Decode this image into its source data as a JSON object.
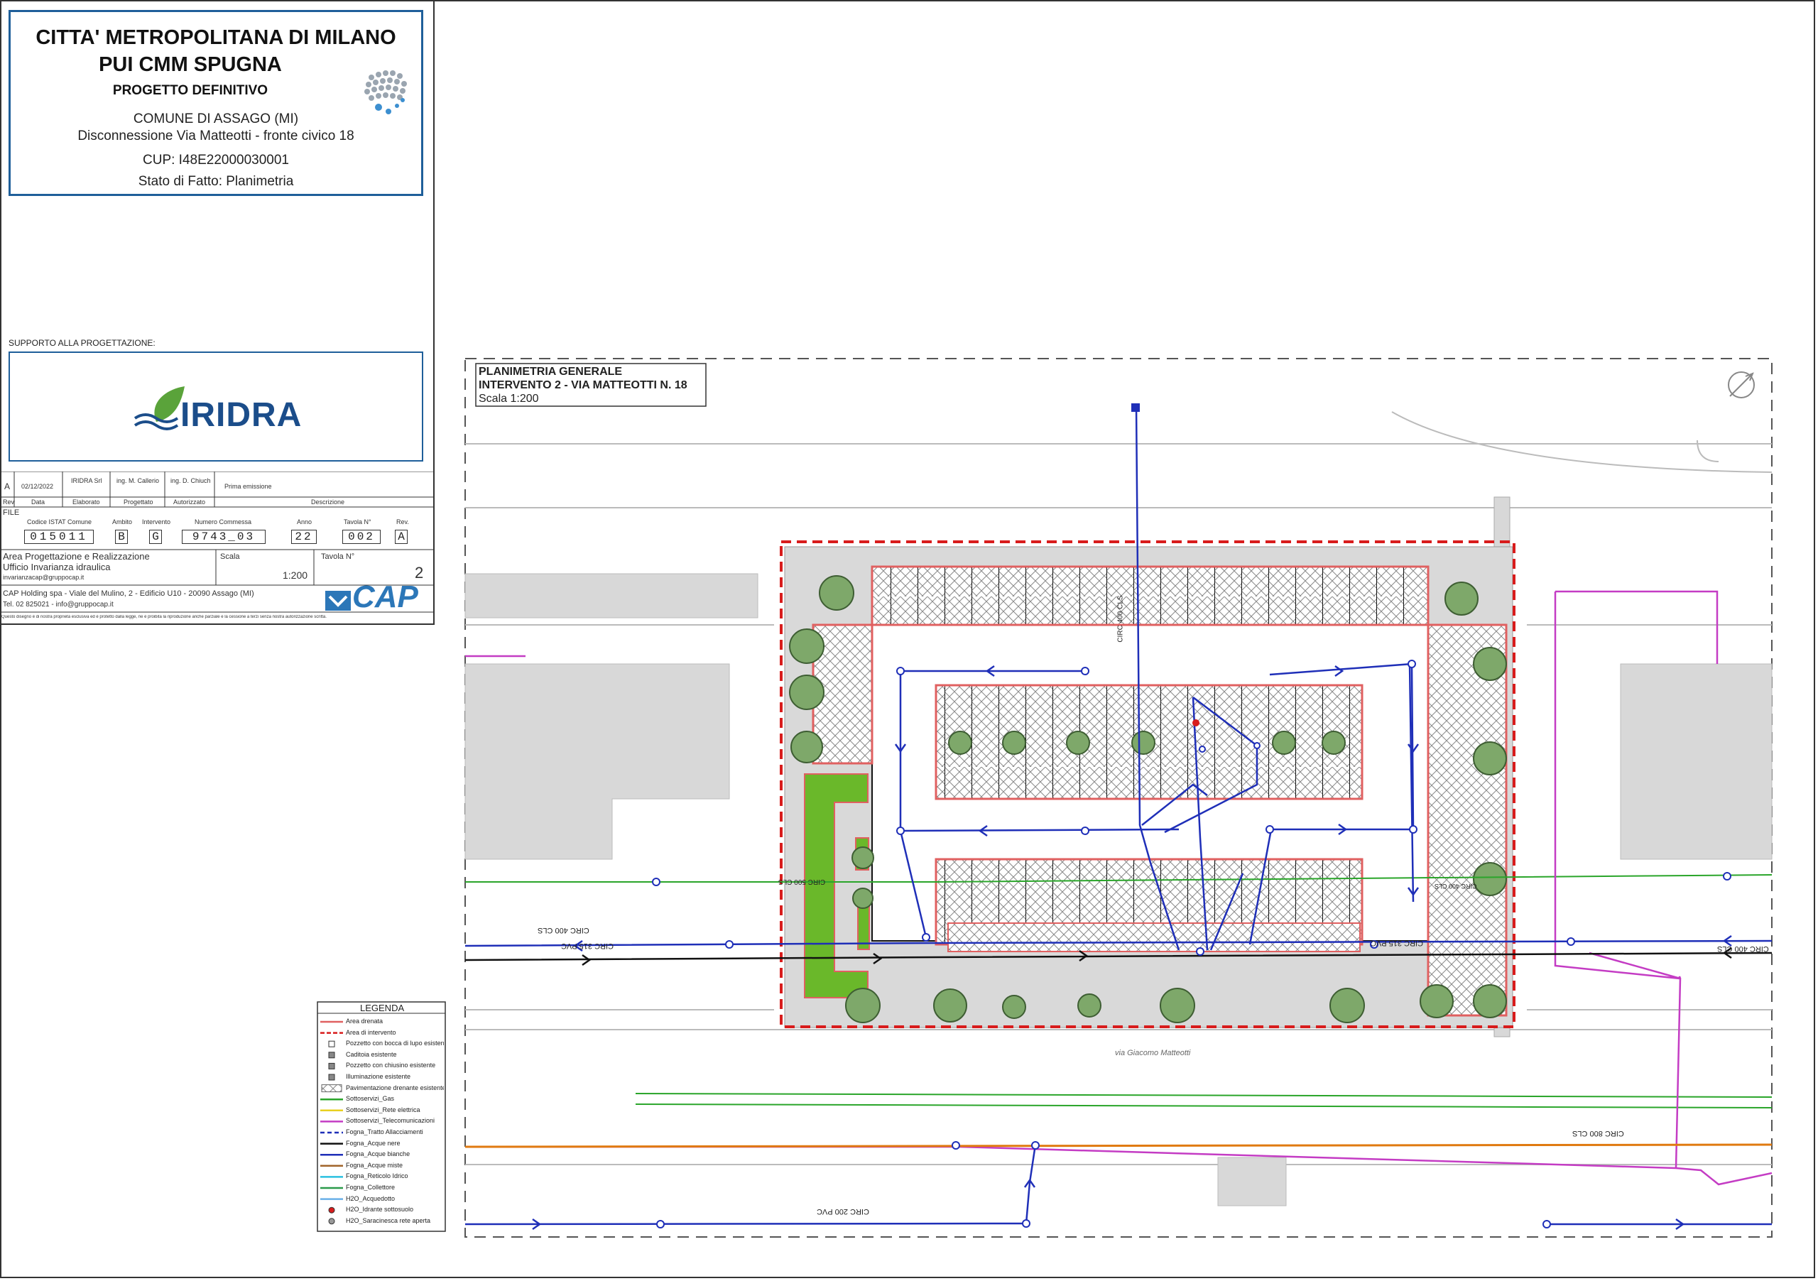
{
  "header": {
    "title_line1": "CITTA' METROPOLITANA DI MILANO",
    "title_line2": "PUI CMM SPUGNA",
    "phase": "PROGETTO DEFINITIVO",
    "comune": "COMUNE DI ASSAGO (MI)",
    "subject": "Disconnessione Via Matteotti - fronte civico 18",
    "cup": "CUP: I48E22000030001",
    "state": "Stato di Fatto: Planimetria"
  },
  "support": {
    "label": "SUPPORTO ALLA PROGETTAZIONE:",
    "logo_text": "IRIDRA"
  },
  "revision": {
    "rev": "A",
    "date": "02/12/2022",
    "elaborato": "IRIDRA Srl",
    "progettato": "ing. M. Callerio",
    "autorizzato": "ing. D. Chiuch",
    "descrizione": "Prima emissione",
    "headers": [
      "Rev",
      "Data",
      "Elaborato",
      "Progettato",
      "Autorizzato",
      "Descrizione"
    ]
  },
  "file": {
    "label": "FILE",
    "headers": [
      "Codice ISTAT Comune",
      "Ambito",
      "Intervento",
      "Numero Commessa",
      "Anno",
      "Tavola N°",
      "Rev."
    ],
    "istat": "015011",
    "ambito": "B",
    "intervento": "G",
    "commessa": "9743_03",
    "anno": "22",
    "tavola": "002",
    "rev": "A"
  },
  "office": {
    "area": "Area Progettazione e Realizzazione",
    "ufficio": "Ufficio Invarianza idraulica",
    "email": "invarianzacap@gruppocap.it",
    "scala_label": "Scala",
    "scala_value": "1:200",
    "tavola_label": "Tavola N°",
    "tavola_value": "2",
    "company": "CAP Holding spa - Viale del Mulino, 2 - Edificio U10 - 20090 Assago (MI)",
    "contacts": "Tel. 02 825021 - info@gruppocap.it",
    "cap_logo": "CAP",
    "disclaimer": "Questo disegno è di nostra proprietà esclusiva ed è protetto dalla legge, ne è proibita la riproduzione anche parziale e la cessione a terzi senza nostra autorizzazione scritta."
  },
  "plan": {
    "title1": "PLANIMETRIA GENERALE",
    "title2": "INTERVENTO 2 - VIA MATTEOTTI N. 18",
    "scale": "Scala 1:200",
    "street": "via Giacomo Matteotti",
    "pipe_labels": {
      "circ400_vertical": "CIRC 400 CLS",
      "circ400_left": "CIRC 400 CLS",
      "circ315_left": "CIRC 315 PVC",
      "circ315_right": "CIRC 315 PVC",
      "circ400_right": "CIRC 400 CLS",
      "circ800": "CIRC 800 CLS",
      "circ200": "CIRC 200 PVC",
      "circ500": "CIRC 500 CLS",
      "circ_small": "CIRC 400 CLS"
    },
    "colors": {
      "drain_area": "#e06060",
      "intervention": "#d81c1c",
      "sewer_white": "#1f2fb8",
      "sewer_black": "#111111",
      "gas": "#2aa52a",
      "telecom": "#c43cc4",
      "aqueduct": "#e07a10",
      "green_strip": "#6ab82a"
    }
  },
  "legend": {
    "title": "LEGENDA",
    "items": [
      {
        "label": "Area drenata",
        "style": "drain"
      },
      {
        "label": "Area di intervento",
        "style": "intervention"
      },
      {
        "label": "Pozzetto con bocca di lupo esistente",
        "style": "symbol"
      },
      {
        "label": "Caditoia esistente",
        "style": "square"
      },
      {
        "label": "Pozzetto con chiusino esistente",
        "style": "square-small"
      },
      {
        "label": "Illuminazione esistente",
        "style": "lamp"
      },
      {
        "label": "Pavimentazione drenante esistente",
        "style": "hatch"
      },
      {
        "label": "Sottoservizi_Gas",
        "style": "gas"
      },
      {
        "label": "Sottoservizi_Rete elettrica",
        "style": "electric"
      },
      {
        "label": "Sottoservizi_Telecomunicazioni",
        "style": "telecom"
      },
      {
        "label": "Fogna_Tratto Allacciamenti",
        "style": "dash-blue"
      },
      {
        "label": "Fogna_Acque nere",
        "style": "black"
      },
      {
        "label": "Fogna_Acque bianche",
        "style": "blue"
      },
      {
        "label": "Fogna_Acque miste",
        "style": "brown"
      },
      {
        "label": "Fogna_Reticolo Idrico",
        "style": "cyan"
      },
      {
        "label": "Fogna_Collettore",
        "style": "green2"
      },
      {
        "label": "H2O_Acquedotto",
        "style": "lightblue"
      },
      {
        "label": "H2O_Idrante sottosuolo",
        "style": "red-dot"
      },
      {
        "label": "H2O_Saracinesca rete aperta",
        "style": "grey-dot"
      }
    ]
  }
}
